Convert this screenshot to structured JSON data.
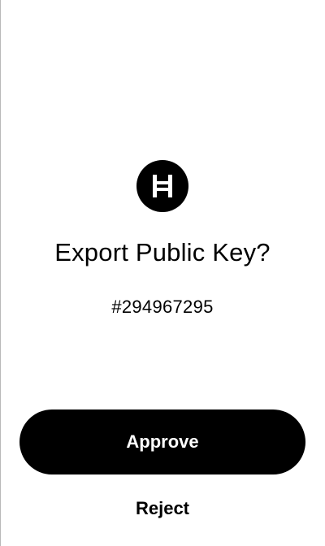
{
  "prompt": {
    "logo_icon": "hedera-hbar-icon",
    "title": "Export Public Key?",
    "account_number": "#294967295"
  },
  "actions": {
    "approve_label": "Approve",
    "reject_label": "Reject"
  },
  "colors": {
    "background": "#ffffff",
    "primary": "#000000",
    "primary_text": "#ffffff"
  }
}
